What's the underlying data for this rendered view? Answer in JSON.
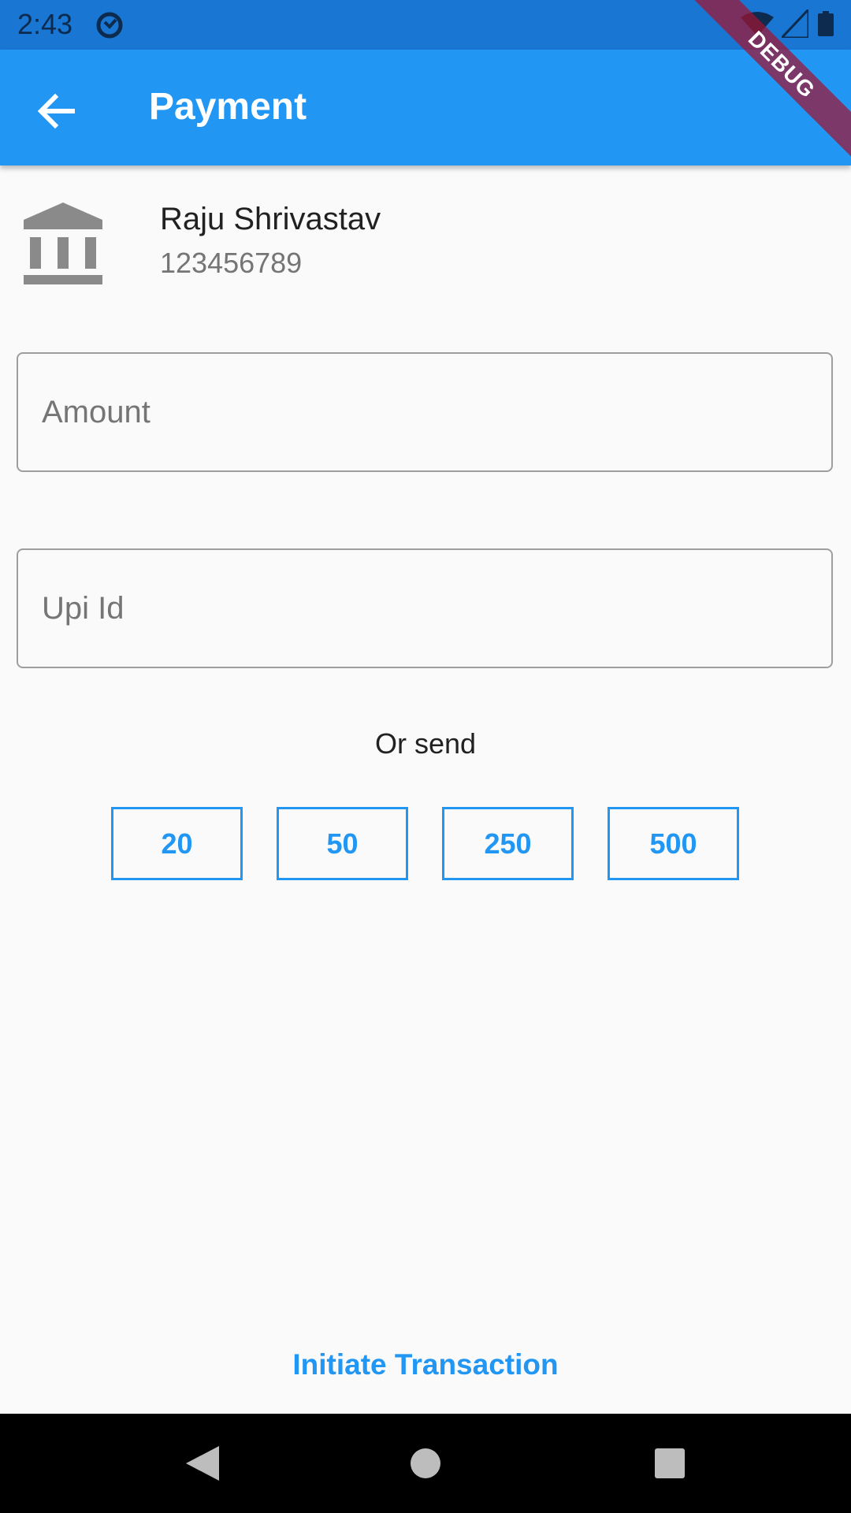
{
  "status_bar": {
    "time": "2:43",
    "icons": [
      "sync-ring-icon",
      "wifi-icon",
      "signal-icon",
      "battery-icon"
    ]
  },
  "app_bar": {
    "title": "Payment",
    "back_icon": "arrow-back-icon",
    "color": "#2196f3"
  },
  "debug_banner": "DEBUG",
  "payee": {
    "icon": "bank-icon",
    "name": "Raju Shrivastav",
    "account": "123456789"
  },
  "form": {
    "amount_placeholder": "Amount",
    "amount_value": "",
    "upi_placeholder": "Upi Id",
    "upi_value": ""
  },
  "quick_send": {
    "label": "Or send",
    "amounts": [
      "20",
      "50",
      "250",
      "500"
    ]
  },
  "action": {
    "initiate_label": "Initiate Transaction"
  },
  "nav_bar": {
    "icons": [
      "nav-back-icon",
      "nav-home-icon",
      "nav-recents-icon"
    ]
  },
  "colors": {
    "accent": "#2196f3",
    "status_bar": "#1976d2",
    "background": "#fafafa"
  }
}
